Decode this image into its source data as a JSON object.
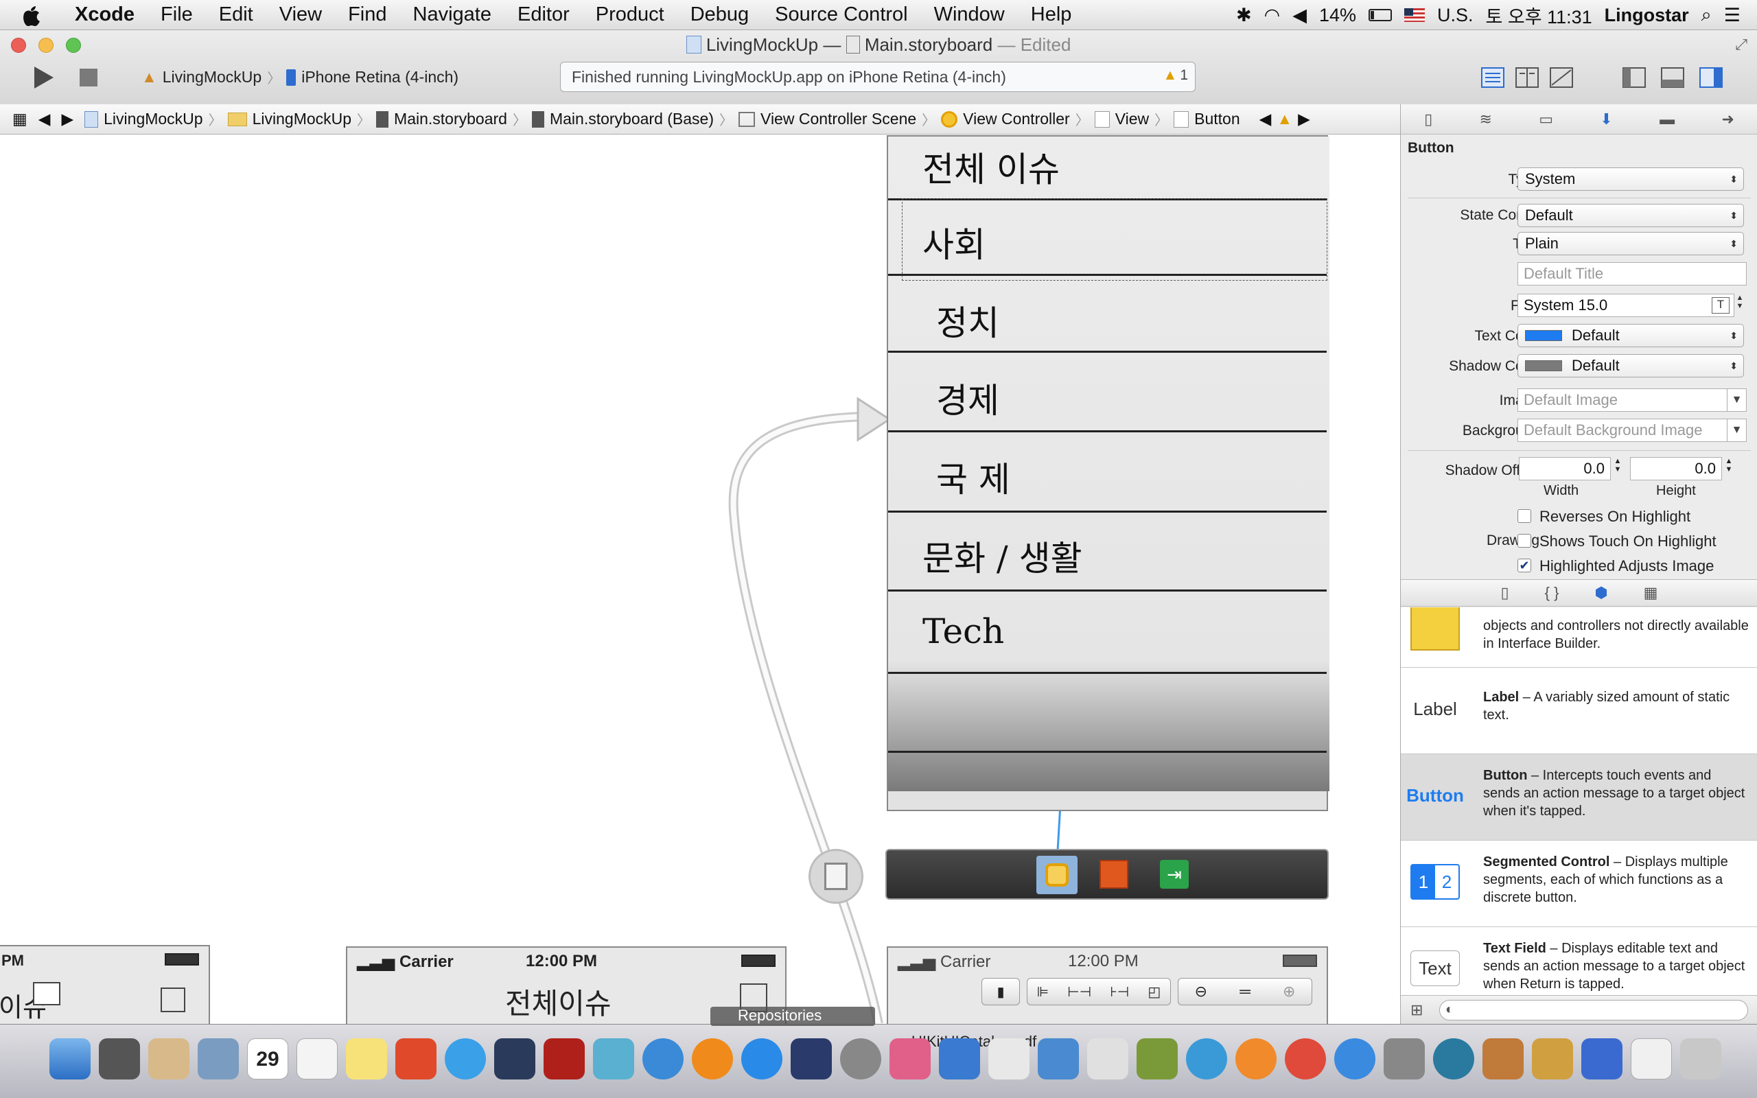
{
  "menubar": {
    "app": "Xcode",
    "items": [
      "File",
      "Edit",
      "View",
      "Find",
      "Navigate",
      "Editor",
      "Product",
      "Debug",
      "Source Control",
      "Window",
      "Help"
    ],
    "battery": "14%",
    "input_source": "U.S.",
    "clock": "토 오후 11:31",
    "user": "Lingostar"
  },
  "window": {
    "project": "LivingMockUp",
    "title_sep": "—",
    "file": "Main.storyboard",
    "edited": "— Edited",
    "scheme": "LivingMockUp",
    "destination": "iPhone Retina (4-inch)",
    "status_message": "Finished running LivingMockUp.app on iPhone Retina (4-inch)",
    "warning_count": "1"
  },
  "jumpbar": [
    "LivingMockUp",
    "LivingMockUp",
    "Main.storyboard",
    "Main.storyboard (Base)",
    "View Controller Scene",
    "View Controller",
    "View",
    "Button"
  ],
  "canvas": {
    "rows": [
      "전체 이슈",
      "사회",
      "정치",
      "경제",
      "국 제",
      "문화 / 생활",
      "Tech"
    ],
    "carrier": "Carrier",
    "time": "12:00 PM",
    "pm_left": "PM",
    "partial_left_text": "이슈",
    "mid_scene_title": "전체이슈",
    "repositories": "Repositories",
    "uikit_file": "UIKitUICatalog.pdf"
  },
  "inspector": {
    "header": "Button",
    "type_label": "Type",
    "type_value": "System",
    "state_label": "State Config",
    "state_value": "Default",
    "title_label": "Title",
    "title_value": "Plain",
    "title_placeholder": "Default Title",
    "font_label": "Font",
    "font_value": "System 15.0",
    "text_color_label": "Text Color",
    "text_color_value": "Default",
    "text_color_swatch": "#1e7cf0",
    "shadow_color_label": "Shadow Color",
    "shadow_color_value": "Default",
    "shadow_color_swatch": "#7a7a7a",
    "image_label": "Image",
    "image_placeholder": "Default Image",
    "background_label": "Background",
    "background_placeholder": "Default Background Image",
    "shadow_offset_label": "Shadow Offset",
    "width_value": "0.0",
    "height_value": "0.0",
    "width_label": "Width",
    "height_label": "Height",
    "reverses": "Reverses On Highlight",
    "drawing_label": "Drawing",
    "shows_touch": "Shows Touch On Highlight",
    "highlighted_adjusts": "Highlighted Adjusts Image"
  },
  "library": [
    {
      "icon": "object-icon",
      "title": "",
      "desc": "objects and controllers not directly available in Interface Builder."
    },
    {
      "icon": "label-icon",
      "icon_text": "Label",
      "title": "Label",
      "desc": " – A variably sized amount of static text."
    },
    {
      "icon": "button-icon",
      "icon_text": "Button",
      "title": "Button",
      "desc": " – Intercepts touch events and sends an action message to a target object when it's tapped."
    },
    {
      "icon": "segmented-control-icon",
      "icon_text": "1 2",
      "title": "Segmented Control",
      "desc": " – Displays multiple segments, each of which functions as a discrete button."
    },
    {
      "icon": "text-field-icon",
      "icon_text": "Text",
      "title": "Text Field",
      "desc": " – Displays editable text and sends an action message to a target object when Return is tapped."
    }
  ],
  "dock": {
    "calendar_day": "29"
  }
}
